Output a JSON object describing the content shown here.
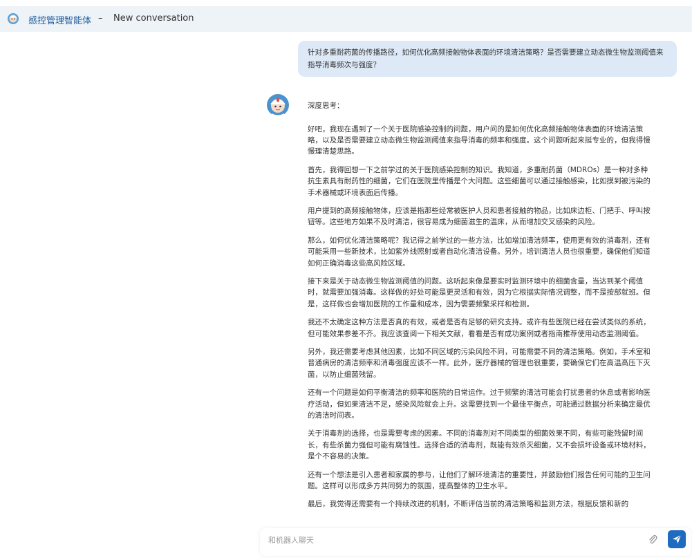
{
  "header": {
    "bot_name": "感控管理智能体",
    "separator": "–",
    "conversation_title": "New conversation"
  },
  "chat": {
    "user_message": "针对多重耐药菌的传播路径，如何优化高频接触物体表面的环境清洁策略？是否需要建立动态微生物监测阈值来指导消毒频次与强度？",
    "thinking_title": "深度思考：",
    "answer_paragraphs": [
      "好吧，我现在遇到了一个关于医院感染控制的问题，用户问的是如何优化高频接触物体表面的环境清洁策略，以及是否需要建立动态微生物监测阈值来指导消毒的频率和强度。这个问题听起来挺专业的，但我得慢慢理清楚思路。",
      "首先，我得回想一下之前学过的关于医院感染控制的知识。我知道，多重耐药菌（MDROs）是一种对多种抗生素具有耐药性的细菌，它们在医院里传播是个大问题。这些细菌可以通过接触感染，比如摸到被污染的手术器械或环境表面后传播。",
      "用户提到的高频接触物体，应该是指那些经常被医护人员和患者接触的物品，比如床边柜、门把手、呼叫按钮等。这些地方如果不及时清洁，很容易成为细菌滋生的温床，从而增加交叉感染的风险。",
      "那么，如何优化清洁策略呢？我记得之前学过的一些方法，比如增加清洁频率，使用更有效的消毒剂，还有可能采用一些新技术，比如紫外线照射或者自动化清洁设备。另外，培训清洁人员也很重要，确保他们知道如何正确消毒这些高风险区域。",
      "接下来是关于动态微生物监测阈值的问题。这听起来像是要实时监测环境中的细菌含量，当达到某个阈值时，就需要加强消毒。这样做的好处可能是更灵活和有效，因为它根据实际情况调整，而不是按部就班。但是，这样做也会增加医院的工作量和成本，因为需要频繁采样和检测。",
      "我还不太确定这种方法是否真的有效，或者是否有足够的研究支持。或许有些医院已经在尝试类似的系统，但可能效果参差不齐。我应该查阅一下相关文献，看看是否有成功案例或者指南推荐使用动态监测阈值。",
      "另外，我还需要考虑其他因素，比如不同区域的污染风险不同，可能需要不同的清洁策略。例如，手术室和普通病房的清洁频率和消毒强度应该不一样。此外，医疗器械的管理也很重要，要确保它们在高温高压下灭菌，以防止细菌残留。",
      "还有一个问题是如何平衡清洁的频率和医院的日常运作。过于频繁的清洁可能会打扰患者的休息或者影响医疗活动，但如果清洁不足，感染风险就会上升。这需要找到一个最佳平衡点，可能通过数据分析来确定最优的清洁时间表。",
      "关于消毒剂的选择，也是需要考虑的因素。不同的消毒剂对不同类型的细菌效果不同，有些可能残留时间长，有些杀菌力强但可能有腐蚀性。选择合适的消毒剂，既能有效杀灭细菌，又不会损坏设备或环境材料，是个不容易的决策。",
      "还有一个想法是引入患者和家属的参与，让他们了解环境清洁的重要性，并鼓励他们报告任何可能的卫生问题。这样可以形成多方共同努力的氛围，提高整体的卫生水平。",
      "最后，我觉得还需要有一个持续改进的机制，不断评估当前的清洁策略和监测方法，根据反馈和新的"
    ]
  },
  "input": {
    "placeholder": "和机器人聊天"
  },
  "icons": {
    "bot": "bot-avatar-icon",
    "attach": "paperclip-icon",
    "send": "send-icon"
  },
  "colors": {
    "accent": "#1e6bbf",
    "header_bg": "#eef3f8",
    "user_bubble_bg": "#dde9f6",
    "bot_name": "#1e5a9a"
  }
}
